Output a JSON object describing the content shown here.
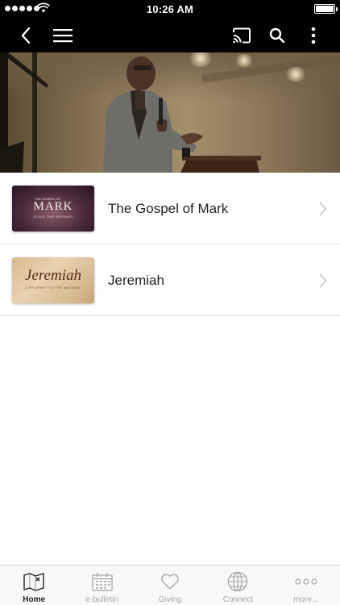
{
  "status_bar": {
    "time": "10:26 AM"
  },
  "nav": {
    "back_icon": "chevron-left-icon",
    "menu_icon": "hamburger-menu-icon",
    "cast_icon": "cast-icon",
    "search_icon": "search-icon",
    "more_icon": "vertical-ellipsis-icon"
  },
  "series": [
    {
      "title": "The Gospel of Mark",
      "thumb_title": "MARK",
      "thumb_pre": "THE GOSPEL OF",
      "thumb_sub": "JESUS THE SERVANT"
    },
    {
      "title": "Jeremiah",
      "thumb_title": "Jeremiah",
      "thumb_sub": "A PROPHET TO THE NATIONS"
    }
  ],
  "tabs": [
    {
      "label": "Home",
      "icon": "map-icon",
      "active": true
    },
    {
      "label": "e-bulletin",
      "icon": "calendar-icon",
      "active": false
    },
    {
      "label": "Giving",
      "icon": "heart-icon",
      "active": false
    },
    {
      "label": "Connect",
      "icon": "globe-icon",
      "active": false
    },
    {
      "label": "more...",
      "icon": "more-dots-icon",
      "active": false
    }
  ],
  "colors": {
    "nav_background": "#000000",
    "active_tab": "#222222",
    "inactive_tab": "#a6a6a6"
  }
}
